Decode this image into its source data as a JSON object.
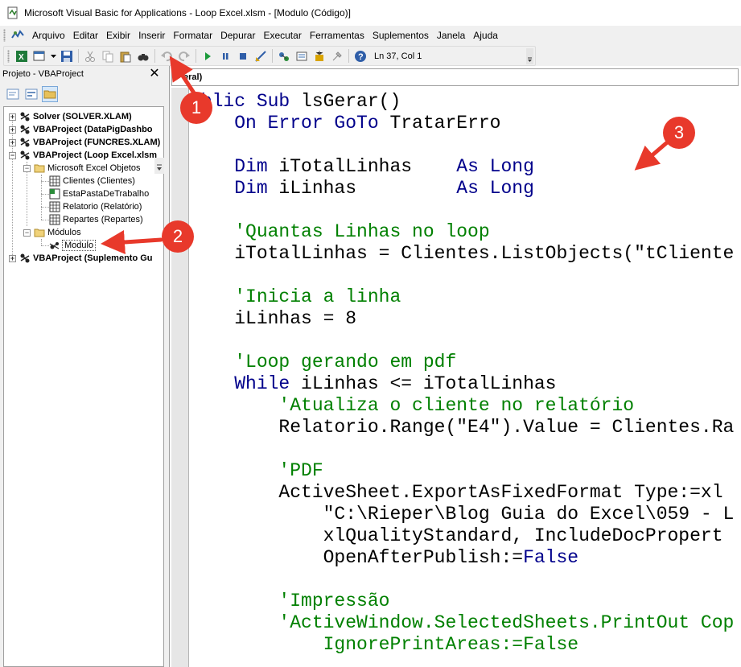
{
  "window": {
    "title": "Microsoft Visual Basic for Applications - Loop Excel.xlsm - [Modulo (Código)]"
  },
  "menu": [
    "Arquivo",
    "Editar",
    "Exibir",
    "Inserir",
    "Formatar",
    "Depurar",
    "Executar",
    "Ferramentas",
    "Suplementos",
    "Janela",
    "Ajuda"
  ],
  "toolbar": {
    "position_text": "Ln 37, Col 1"
  },
  "project": {
    "title": "Projeto - VBAProject",
    "close_label": "✕",
    "nodes": [
      {
        "label": "Solver (SOLVER.XLAM)",
        "level": 0,
        "expander": "+",
        "bold": true
      },
      {
        "label": "VBAProject (DataPigDashbo",
        "level": 0,
        "expander": "+",
        "bold": true
      },
      {
        "label": "VBAProject (FUNCRES.XLAM)",
        "level": 0,
        "expander": "+",
        "bold": true
      },
      {
        "label": "VBAProject (Loop Excel.xlsm",
        "level": 0,
        "expander": "−",
        "bold": true
      },
      {
        "label": "Microsoft Excel Objetos",
        "level": 1,
        "expander": "−",
        "bold": false
      },
      {
        "label": "Clientes (Clientes)",
        "level": 2,
        "expander": "",
        "bold": false
      },
      {
        "label": "EstaPastaDeTrabalho",
        "level": 2,
        "expander": "",
        "bold": false
      },
      {
        "label": "Relatorio (Relatório)",
        "level": 2,
        "expander": "",
        "bold": false
      },
      {
        "label": "Repartes (Repartes)",
        "level": 2,
        "expander": "",
        "bold": false
      },
      {
        "label": "Módulos",
        "level": 1,
        "expander": "−",
        "bold": false
      },
      {
        "label": "Modulo",
        "level": 2,
        "expander": "",
        "bold": false
      },
      {
        "label": "VBAProject (Suplemento Gu",
        "level": 0,
        "expander": "+",
        "bold": true
      }
    ]
  },
  "code": {
    "object_combo": "eral)",
    "lines": [
      [
        {
          "t": "ublic Sub ",
          "c": "kw"
        },
        {
          "t": "lsGerar()",
          "c": ""
        }
      ],
      [
        {
          "t": "    On Error GoTo ",
          "c": "kw"
        },
        {
          "t": "TratarErro",
          "c": ""
        }
      ],
      [],
      [
        {
          "t": "    Dim ",
          "c": "kw"
        },
        {
          "t": "iTotalLinhas    ",
          "c": ""
        },
        {
          "t": "As Long",
          "c": "kw"
        }
      ],
      [
        {
          "t": "    Dim ",
          "c": "kw"
        },
        {
          "t": "iLinhas         ",
          "c": ""
        },
        {
          "t": "As Long",
          "c": "kw"
        }
      ],
      [],
      [
        {
          "t": "    'Quantas Linhas no loop",
          "c": "cm"
        }
      ],
      [
        {
          "t": "    iTotalLinhas = Clientes.ListObjects(\"tCliente",
          "c": ""
        }
      ],
      [],
      [
        {
          "t": "    'Inicia a linha",
          "c": "cm"
        }
      ],
      [
        {
          "t": "    iLinhas = 8",
          "c": ""
        }
      ],
      [],
      [
        {
          "t": "    'Loop gerando em pdf",
          "c": "cm"
        }
      ],
      [
        {
          "t": "    While ",
          "c": "kw"
        },
        {
          "t": "iLinhas <= iTotalLinhas",
          "c": ""
        }
      ],
      [
        {
          "t": "        'Atualiza o cliente no relatório",
          "c": "cm"
        }
      ],
      [
        {
          "t": "        Relatorio.Range(\"E4\").Value = Clientes.Ra",
          "c": ""
        }
      ],
      [],
      [
        {
          "t": "        'PDF",
          "c": "cm"
        }
      ],
      [
        {
          "t": "        ActiveSheet.ExportAsFixedFormat Type:=xl",
          "c": ""
        }
      ],
      [
        {
          "t": "            \"C:\\Rieper\\Blog Guia do Excel\\059 - L",
          "c": ""
        }
      ],
      [
        {
          "t": "            xlQualityStandard, IncludeDocPropert",
          "c": ""
        }
      ],
      [
        {
          "t": "            OpenAfterPublish:=",
          "c": ""
        },
        {
          "t": "False",
          "c": "kw"
        }
      ],
      [],
      [
        {
          "t": "        'Impressão",
          "c": "cm"
        }
      ],
      [
        {
          "t": "        'ActiveWindow.SelectedSheets.PrintOut Cop",
          "c": "cm"
        }
      ],
      [
        {
          "t": "            IgnorePrintAreas:=False",
          "c": "cm"
        }
      ]
    ]
  },
  "annotations": [
    {
      "label": "1"
    },
    {
      "label": "2"
    },
    {
      "label": "3"
    }
  ],
  "colors": {
    "keyword": "#00008b",
    "comment": "#008000",
    "annotation": "#e8392b"
  }
}
